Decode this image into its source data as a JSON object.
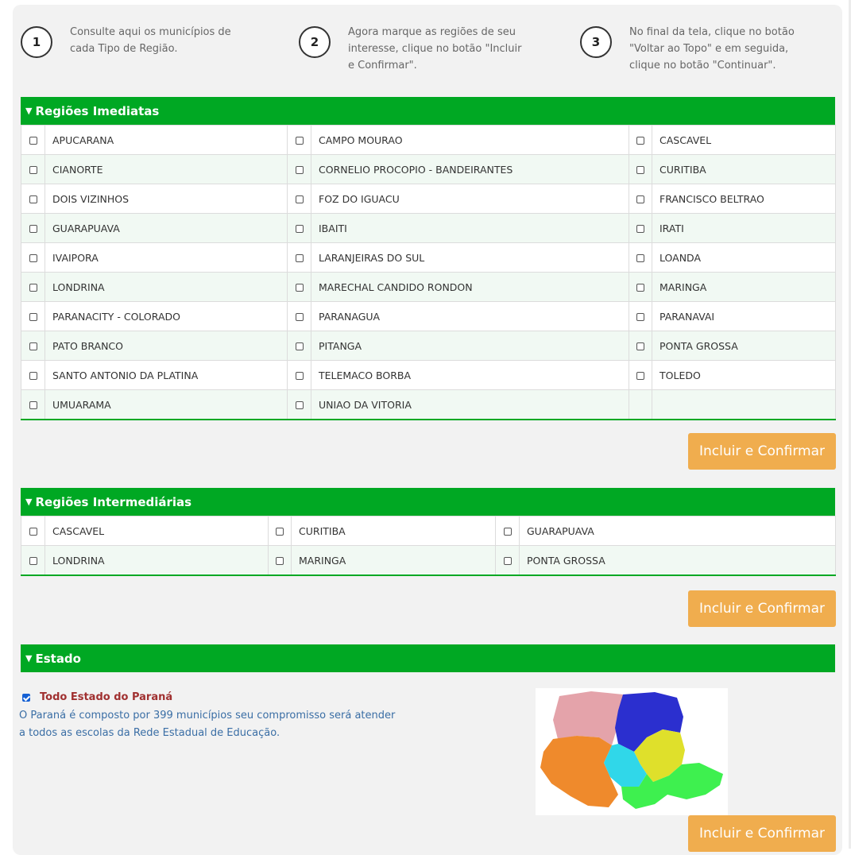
{
  "steps": [
    {
      "num": "1",
      "text_lines": [
        "Consulte aqui os municípios de",
        "cada Tipo de Região."
      ]
    },
    {
      "num": "2",
      "text_lines": [
        "Agora marque as regiões de seu",
        "interesse, clique no botão \"Incluir",
        "e Confirmar\"."
      ]
    },
    {
      "num": "3",
      "text_lines": [
        "No final da tela, clique no botão",
        "\"Voltar ao Topo\" e em seguida,",
        "clique no botão \"Continuar\"."
      ]
    }
  ],
  "regioes_imediatas": {
    "title": "Regiões Imediatas",
    "rows": [
      [
        "APUCARANA",
        "CAMPO MOURAO",
        "CASCAVEL"
      ],
      [
        "CIANORTE",
        "CORNELIO PROCOPIO - BANDEIRANTES",
        "CURITIBA"
      ],
      [
        "DOIS VIZINHOS",
        "FOZ DO IGUACU",
        "FRANCISCO BELTRAO"
      ],
      [
        "GUARAPUAVA",
        "IBAITI",
        "IRATI"
      ],
      [
        "IVAIPORA",
        "LARANJEIRAS DO SUL",
        "LOANDA"
      ],
      [
        "LONDRINA",
        "MARECHAL CANDIDO RONDON",
        "MARINGA"
      ],
      [
        "PARANACITY - COLORADO",
        "PARANAGUA",
        "PARANAVAI"
      ],
      [
        "PATO BRANCO",
        "PITANGA",
        "PONTA GROSSA"
      ],
      [
        "SANTO ANTONIO DA PLATINA",
        "TELEMACO BORBA",
        "TOLEDO"
      ],
      [
        "UMUARAMA",
        "UNIAO DA VITORIA",
        ""
      ]
    ]
  },
  "regioes_intermediarias": {
    "title": "Regiões Intermediárias",
    "rows": [
      [
        "CASCAVEL",
        "CURITIBA",
        "GUARAPUAVA"
      ],
      [
        "LONDRINA",
        "MARINGA",
        "PONTA GROSSA"
      ]
    ]
  },
  "estado": {
    "title": "Estado",
    "checkbox_label": "Todo Estado do Paraná",
    "checked": true,
    "description_lines": [
      "O Paraná é composto por 399 municípios seu compromisso será atender",
      "a todos as escolas da Rede Estadual de Educação."
    ]
  },
  "button_label": "Incluir e Confirmar",
  "colors": {
    "header_green": "#00a823",
    "button_orange": "#f0ad4e",
    "label_red": "#a03030",
    "desc_blue": "#3a6ea5"
  }
}
